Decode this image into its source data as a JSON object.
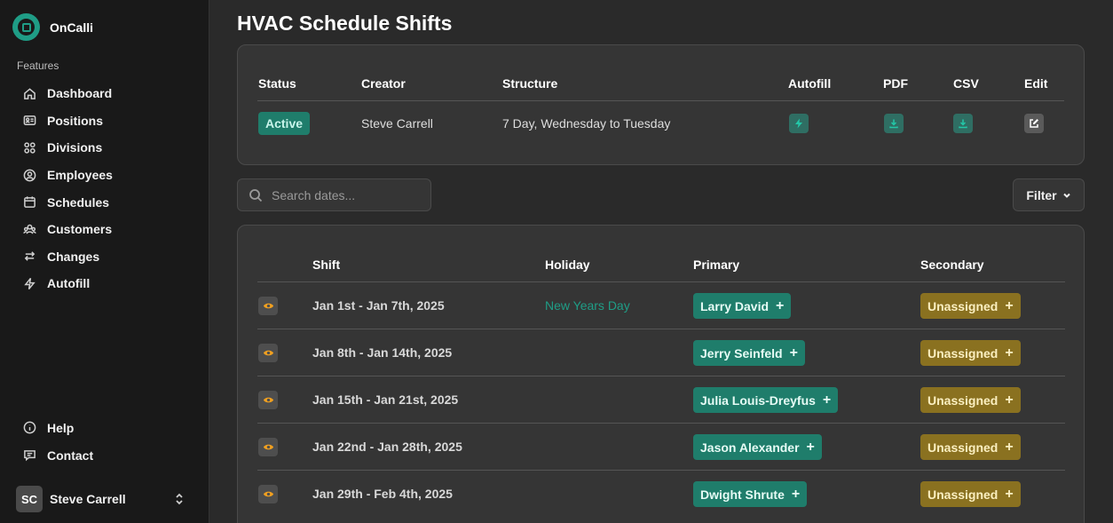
{
  "brand": {
    "name": "OnCalli",
    "logo_icon": "oncalli-logo-icon"
  },
  "sidebar": {
    "section_label": "Features",
    "items": [
      {
        "label": "Dashboard",
        "icon": "home-icon"
      },
      {
        "label": "Positions",
        "icon": "id-card-icon"
      },
      {
        "label": "Divisions",
        "icon": "grid-icon"
      },
      {
        "label": "Employees",
        "icon": "user-circle-icon"
      },
      {
        "label": "Schedules",
        "icon": "calendar-icon"
      },
      {
        "label": "Customers",
        "icon": "customers-icon"
      },
      {
        "label": "Changes",
        "icon": "swap-arrows-icon"
      },
      {
        "label": "Autofill",
        "icon": "bolt-icon"
      }
    ],
    "bottom_items": [
      {
        "label": "Help",
        "icon": "info-icon"
      },
      {
        "label": "Contact",
        "icon": "message-icon"
      }
    ],
    "user": {
      "initials": "SC",
      "name": "Steve Carrell"
    }
  },
  "page": {
    "title": "HVAC Schedule Shifts"
  },
  "summary": {
    "headers": {
      "status": "Status",
      "creator": "Creator",
      "structure": "Structure",
      "autofill": "Autofill",
      "pdf": "PDF",
      "csv": "CSV",
      "edit": "Edit"
    },
    "row": {
      "status": "Active",
      "creator": "Steve Carrell",
      "structure": "7 Day, Wednesday to Tuesday"
    }
  },
  "search": {
    "placeholder": "Search dates..."
  },
  "filter": {
    "label": "Filter"
  },
  "shifts": {
    "headers": {
      "shift": "Shift",
      "holiday": "Holiday",
      "primary": "Primary",
      "secondary": "Secondary"
    },
    "rows": [
      {
        "range": "Jan 1st - Jan 7th, 2025",
        "holiday": "New Years Day",
        "primary": "Larry David",
        "secondary": "Unassigned"
      },
      {
        "range": "Jan 8th - Jan 14th, 2025",
        "holiday": "",
        "primary": "Jerry Seinfeld",
        "secondary": "Unassigned"
      },
      {
        "range": "Jan 15th - Jan 21st, 2025",
        "holiday": "",
        "primary": "Julia Louis-Dreyfus",
        "secondary": "Unassigned"
      },
      {
        "range": "Jan 22nd - Jan 28th, 2025",
        "holiday": "",
        "primary": "Jason Alexander",
        "secondary": "Unassigned"
      },
      {
        "range": "Jan 29th - Feb 4th, 2025",
        "holiday": "",
        "primary": "Dwight Shrute",
        "secondary": "Unassigned"
      }
    ]
  },
  "colors": {
    "accent": "#1f9d86",
    "primary_pill": "#1f7d6b",
    "secondary_pill": "#8a7120",
    "eye_icon": "#f0a020"
  }
}
